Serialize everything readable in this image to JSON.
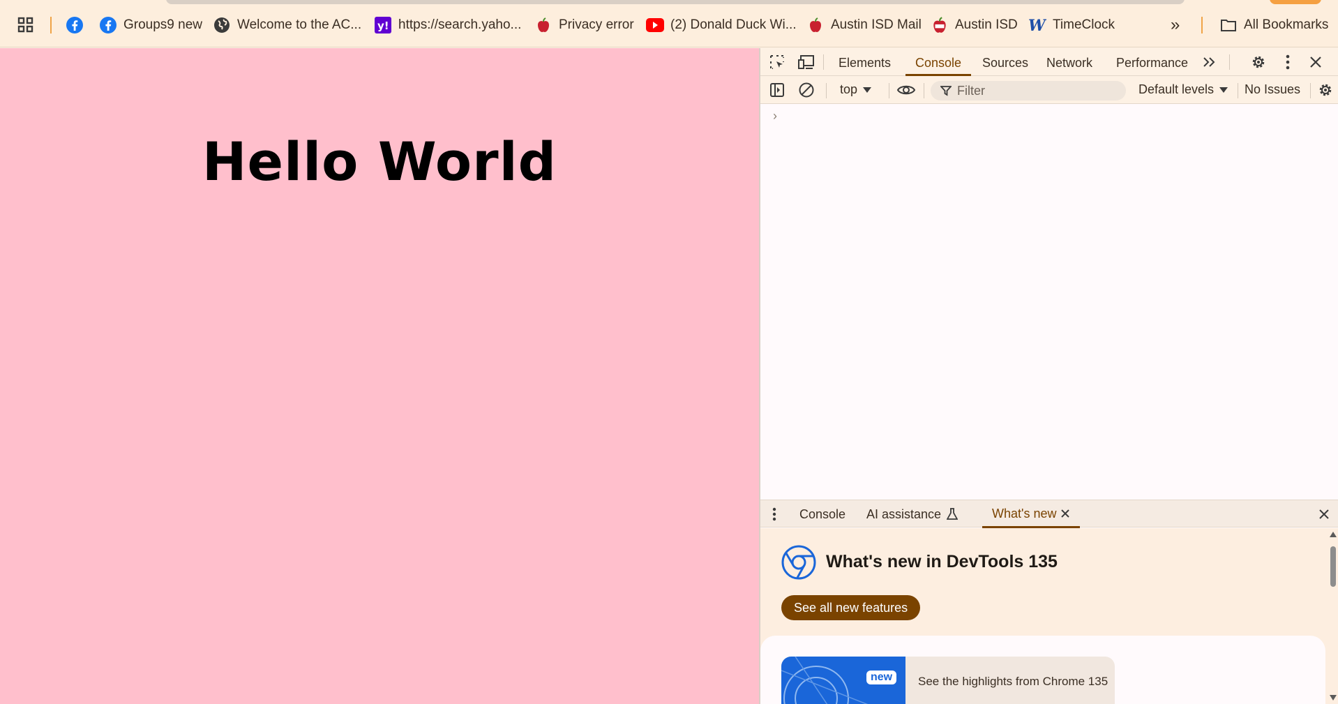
{
  "bookmarks": {
    "items": [
      {
        "label": "Groups9 new",
        "icon": "facebook-icon"
      },
      {
        "label": "Welcome to the AC...",
        "icon": "globe-icon"
      },
      {
        "label": "https://search.yaho...",
        "icon": "yahoo-icon"
      },
      {
        "label": "Privacy error",
        "icon": "apple-icon"
      },
      {
        "label": "(2) Donald Duck Wi...",
        "icon": "youtube-icon"
      },
      {
        "label": "Austin ISD Mail",
        "icon": "apple-icon"
      },
      {
        "label": "Austin ISD",
        "icon": "apple-icon"
      },
      {
        "label": "TimeClock",
        "icon": "w-logo-icon"
      }
    ],
    "more_label": "»",
    "all_bookmarks": "All Bookmarks"
  },
  "page": {
    "heading": "Hello World",
    "background": "#ffbfcc"
  },
  "devtools": {
    "tabs": [
      "Elements",
      "Console",
      "Sources",
      "Network",
      "Performance"
    ],
    "active_tab": "Console",
    "toolbar": {
      "context": "top",
      "filter_placeholder": "Filter",
      "levels": "Default levels",
      "issues": "No Issues"
    },
    "prompt": "›",
    "drawer": {
      "tabs": [
        "Console",
        "AI assistance",
        "What's new"
      ],
      "active_tab": "What's new",
      "title": "What's new in DevTools 135",
      "button": "See all new features",
      "card_badge": "new",
      "card_text": "See the highlights from Chrome 135"
    },
    "accent": "#7a4300"
  }
}
